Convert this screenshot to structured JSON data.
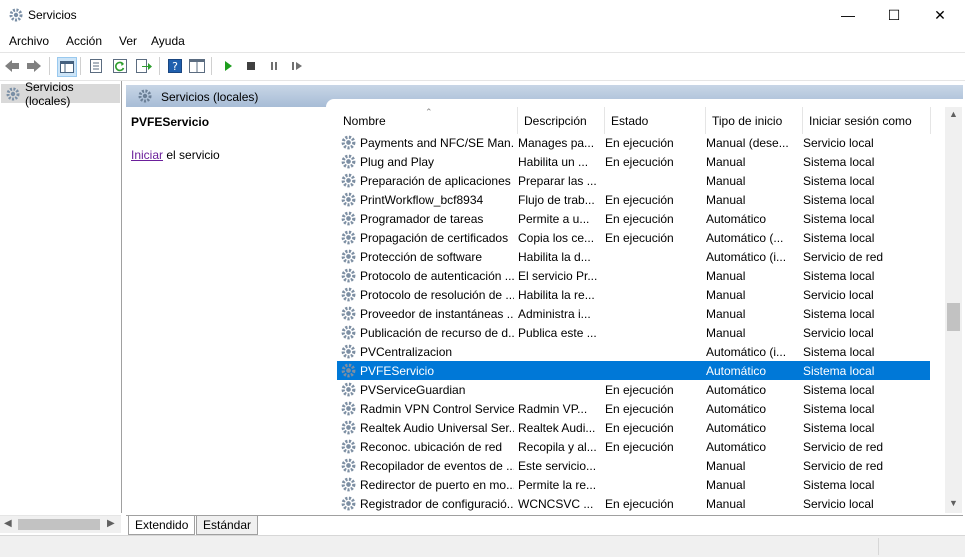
{
  "window": {
    "title": "Servicios",
    "minimize": "—",
    "maximize": "☐",
    "close": "✕"
  },
  "menu": [
    "Archivo",
    "Acción",
    "Ver",
    "Ayuda"
  ],
  "toolbar_icons": [
    "back-arrow-icon",
    "forward-arrow-icon",
    "console-tree-icon",
    "properties-icon",
    "refresh-icon",
    "export-icon",
    "help-icon",
    "show-hide-icon",
    "start-service-icon",
    "stop-service-icon",
    "pause-service-icon",
    "restart-service-icon"
  ],
  "tree": {
    "item": "Servicios (locales)"
  },
  "header": {
    "title": "Servicios (locales)"
  },
  "description": {
    "service_name": "PVFEServicio",
    "start_link": "Iniciar",
    "start_suffix": " el servicio"
  },
  "columns": [
    "Nombre",
    "Descripción",
    "Estado",
    "Tipo de inicio",
    "Iniciar sesión como"
  ],
  "rows": [
    [
      "Payments and NFC/SE Man...",
      "Manages pa...",
      "En ejecución",
      "Manual (dese...",
      "Servicio local"
    ],
    [
      "Plug and Play",
      "Habilita un ...",
      "En ejecución",
      "Manual",
      "Sistema local"
    ],
    [
      "Preparación de aplicaciones",
      "Preparar las ...",
      "",
      "Manual",
      "Sistema local"
    ],
    [
      "PrintWorkflow_bcf8934",
      "Flujo de trab...",
      "En ejecución",
      "Manual",
      "Sistema local"
    ],
    [
      "Programador de tareas",
      "Permite a u...",
      "En ejecución",
      "Automático",
      "Sistema local"
    ],
    [
      "Propagación de certificados",
      "Copia los ce...",
      "En ejecución",
      "Automático (...",
      "Sistema local"
    ],
    [
      "Protección de software",
      "Habilita la d...",
      "",
      "Automático (i...",
      "Servicio de red"
    ],
    [
      "Protocolo de autenticación ...",
      "El servicio Pr...",
      "",
      "Manual",
      "Sistema local"
    ],
    [
      "Protocolo de resolución de ...",
      "Habilita la re...",
      "",
      "Manual",
      "Servicio local"
    ],
    [
      "Proveedor de instantáneas ...",
      "Administra i...",
      "",
      "Manual",
      "Sistema local"
    ],
    [
      "Publicación de recurso de d...",
      "Publica este ...",
      "",
      "Manual",
      "Servicio local"
    ],
    [
      "PVCentralizacion",
      "",
      "",
      "Automático (i...",
      "Sistema local"
    ],
    [
      "PVFEServicio",
      "",
      "",
      "Automático",
      "Sistema local"
    ],
    [
      "PVServiceGuardian",
      "",
      "En ejecución",
      "Automático",
      "Sistema local"
    ],
    [
      "Radmin VPN Control Service",
      "Radmin VP...",
      "En ejecución",
      "Automático",
      "Sistema local"
    ],
    [
      "Realtek Audio Universal Ser...",
      "Realtek Audi...",
      "En ejecución",
      "Automático",
      "Sistema local"
    ],
    [
      "Reconoc. ubicación de red",
      "Recopila y al...",
      "En ejecución",
      "Automático",
      "Servicio de red"
    ],
    [
      "Recopilador de eventos de ...",
      "Este servicio...",
      "",
      "Manual",
      "Servicio de red"
    ],
    [
      "Redirector de puerto en mo...",
      "Permite la re...",
      "",
      "Manual",
      "Sistema local"
    ],
    [
      "Registrador de configuració...",
      "WCNCSVC ...",
      "En ejecución",
      "Manual",
      "Servicio local"
    ]
  ],
  "selected_row": "PVFEServicio",
  "tabs": [
    "Extendido",
    "Estándar"
  ],
  "colors": {
    "selection": "#0078d7",
    "header_gradient_top": "#c8d6e6",
    "link": "#6b1f9b"
  }
}
